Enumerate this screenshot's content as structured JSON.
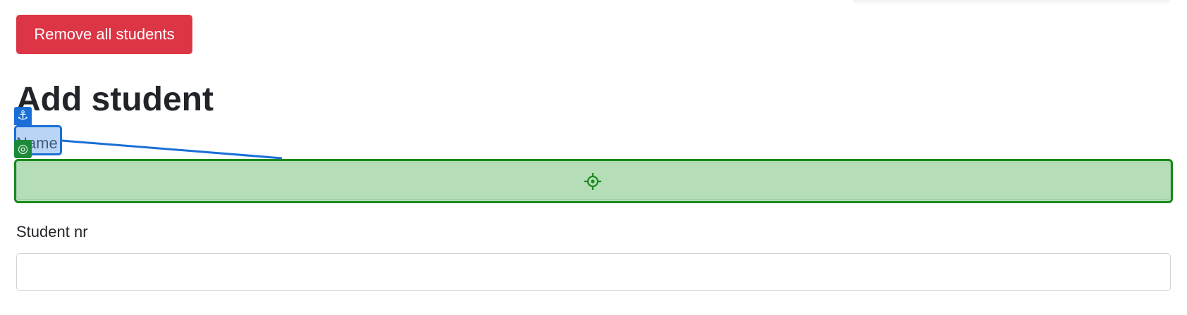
{
  "actions": {
    "remove_all_label": "Remove all students"
  },
  "form": {
    "heading": "Add student",
    "name_label": "Name",
    "name_value": "",
    "student_nr_label": "Student nr",
    "student_nr_value": ""
  },
  "overlay": {
    "anchor_icon": "anchor-icon",
    "target_icon": "target-icon",
    "crosshair_icon": "crosshair-icon",
    "anchor_glyph": "⚓",
    "target_glyph": "◎"
  },
  "colors": {
    "danger": "#dc3545",
    "anchor_blue": "#1a6fd6",
    "target_green": "#1a8a1a",
    "text": "#212529",
    "input_border": "#ced4da"
  }
}
